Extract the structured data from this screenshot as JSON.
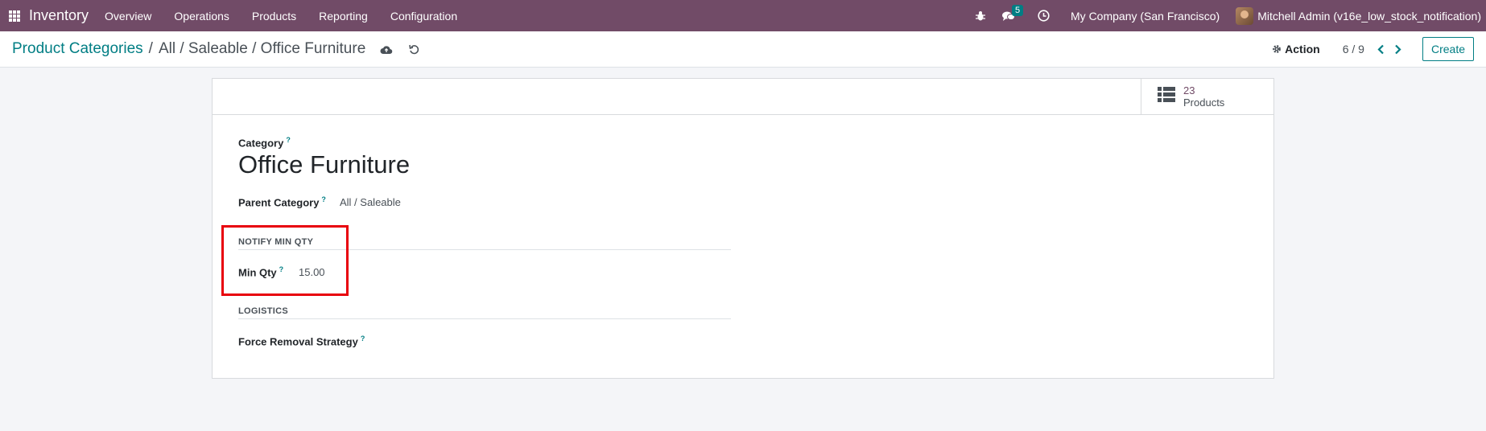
{
  "navbar": {
    "app_name": "Inventory",
    "menu": [
      "Overview",
      "Operations",
      "Products",
      "Reporting",
      "Configuration"
    ],
    "chat_count": "5",
    "company": "My Company (San Francisco)",
    "user": "Mitchell Admin (v16e_low_stock_notification)"
  },
  "control": {
    "breadcrumb_root": "Product Categories",
    "breadcrumb_sep": "/",
    "breadcrumb_current": "All / Saleable / Office Furniture",
    "action_label": "Action",
    "pager": "6 / 9",
    "create_label": "Create"
  },
  "stat_button": {
    "value": "23",
    "label": "Products"
  },
  "form": {
    "category_label": "Category",
    "category_name": "Office Furniture",
    "parent_label": "Parent Category",
    "parent_value": "All / Saleable",
    "notify_group": "NOTIFY MIN QTY",
    "min_qty_label": "Min Qty",
    "min_qty_value": "15.00",
    "logistics_group": "LOGISTICS",
    "removal_label": "Force Removal Strategy",
    "help_mark": "?"
  },
  "colors": {
    "navbar": "#714b67",
    "accent": "#017e84",
    "highlight": "#e8000b"
  }
}
